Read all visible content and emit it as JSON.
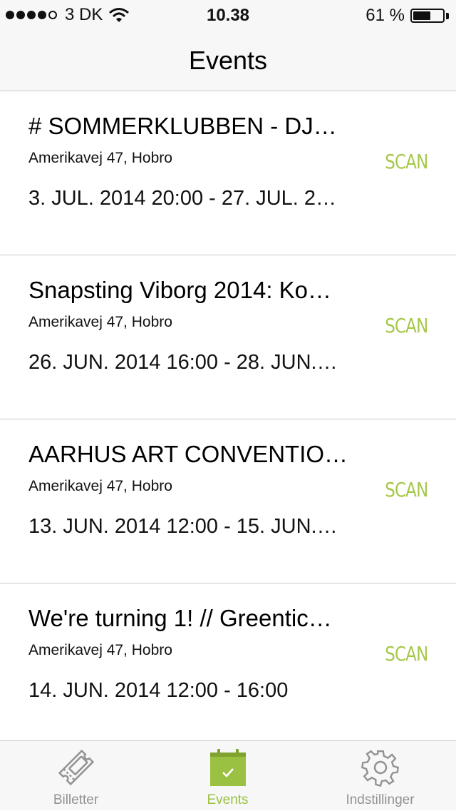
{
  "status_bar": {
    "carrier": "3 DK",
    "time": "10.38",
    "battery_percent": "61 %",
    "battery_level": 0.61,
    "signal_bars": 4,
    "signal_max": 5
  },
  "nav": {
    "title": "Events"
  },
  "events": [
    {
      "title": "# SOMMERKLUBBEN - DJ…",
      "location": "Amerikavej 47, Hobro",
      "date": "3. JUL. 2014 20:00 - 27. JUL. 2…",
      "action": "SCAN"
    },
    {
      "title": "Snapsting Viborg 2014: Ko…",
      "location": "Amerikavej 47, Hobro",
      "date": "26. JUN. 2014 16:00 - 28. JUN.…",
      "action": "SCAN"
    },
    {
      "title": "AARHUS ART CONVENTIO…",
      "location": "Amerikavej 47, Hobro",
      "date": "13. JUN. 2014 12:00 - 15. JUN.…",
      "action": "SCAN"
    },
    {
      "title": " We're turning 1! // Greentic…",
      "location": "Amerikavej 47, Hobro",
      "date": "14. JUN. 2014 12:00 - 16:00",
      "action": "SCAN"
    }
  ],
  "tabs": [
    {
      "label": "Billetter",
      "icon": "ticket-icon",
      "active": false
    },
    {
      "label": "Events",
      "icon": "calendar-check-icon",
      "active": true
    },
    {
      "label": "Indstillinger",
      "icon": "gear-icon",
      "active": false
    }
  ],
  "colors": {
    "accent": "#9bc142",
    "scan": "#a6c84a",
    "inactive_tab": "#929292",
    "bar_background": "#f7f7f7",
    "separator": "#c8c8cc"
  }
}
